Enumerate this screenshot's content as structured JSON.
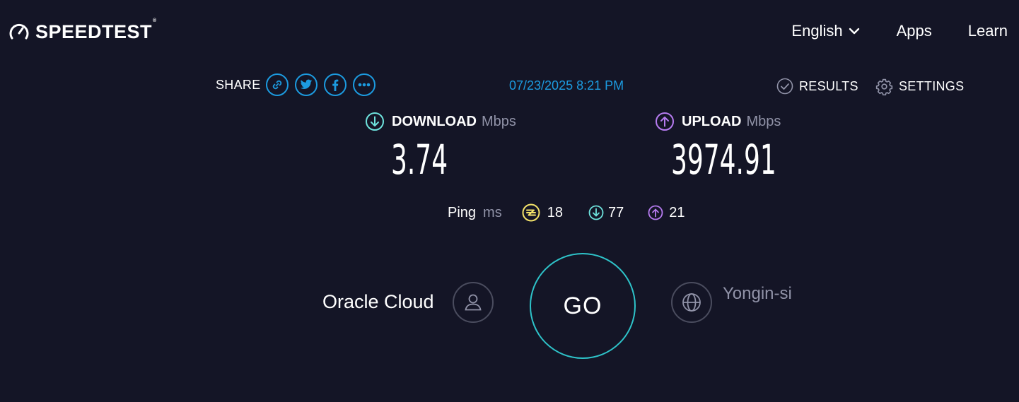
{
  "header": {
    "brand": "SPEEDTEST",
    "brand_mark": "®",
    "nav": {
      "language": "English",
      "apps": "Apps",
      "learn": "Learn"
    }
  },
  "toolbar": {
    "share_label": "SHARE",
    "share_buttons": [
      "link-icon",
      "twitter-icon",
      "facebook-icon",
      "more-icon"
    ],
    "timestamp": "07/23/2025 8:21 PM",
    "results_label": "RESULTS",
    "settings_label": "SETTINGS"
  },
  "download": {
    "label": "DOWNLOAD",
    "unit": "Mbps",
    "value": "3.74"
  },
  "upload": {
    "label": "UPLOAD",
    "unit": "Mbps",
    "value": "3974.91"
  },
  "ping": {
    "label": "Ping",
    "unit": "ms",
    "idle": "18",
    "download": "77",
    "upload": "21"
  },
  "connection": {
    "isp": "Oracle Cloud",
    "server": "Yongin-si",
    "go_label": "GO"
  },
  "colors": {
    "background": "#141526",
    "accent_blue": "#1c9be0",
    "download_teal": "#6ee3dd",
    "upload_purple": "#b67bf0",
    "ping_yellow": "#f4e36a",
    "go_ring": "#2ec3c9",
    "muted_text": "#9193a8"
  }
}
